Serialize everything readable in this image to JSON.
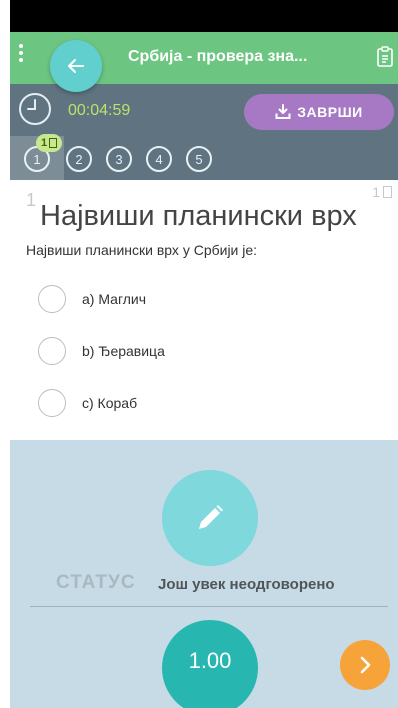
{
  "app_bar": {
    "title": "Србија - провера зна...",
    "back_icon": "arrow-left-icon",
    "menu_icon": "more-vert-icon",
    "clipboard_icon": "clipboard-icon",
    "color": "#6cc581"
  },
  "timer": {
    "value": "00:04:59",
    "finish_label": "ЗАВРШИ",
    "clock_icon": "clock-icon",
    "download_icon": "download-icon",
    "accent": "#a779c4"
  },
  "question_nav": {
    "items": [
      "1",
      "2",
      "3",
      "4",
      "5"
    ],
    "active": "1",
    "badge": "1"
  },
  "question": {
    "index": "1",
    "points": "1",
    "title": "Највиши планински врх",
    "text": "Највиши планински врх у Србији је:",
    "options": [
      {
        "label": "a)  Маглич"
      },
      {
        "label": "b)  Ђеравица"
      },
      {
        "label": "c)  Кораб"
      }
    ]
  },
  "status": {
    "label": "СТАТУС",
    "value": "Још увек неодговорено",
    "edit_icon": "pencil-icon"
  },
  "score": {
    "value": "1.00",
    "next_icon": "chevron-right-icon"
  }
}
